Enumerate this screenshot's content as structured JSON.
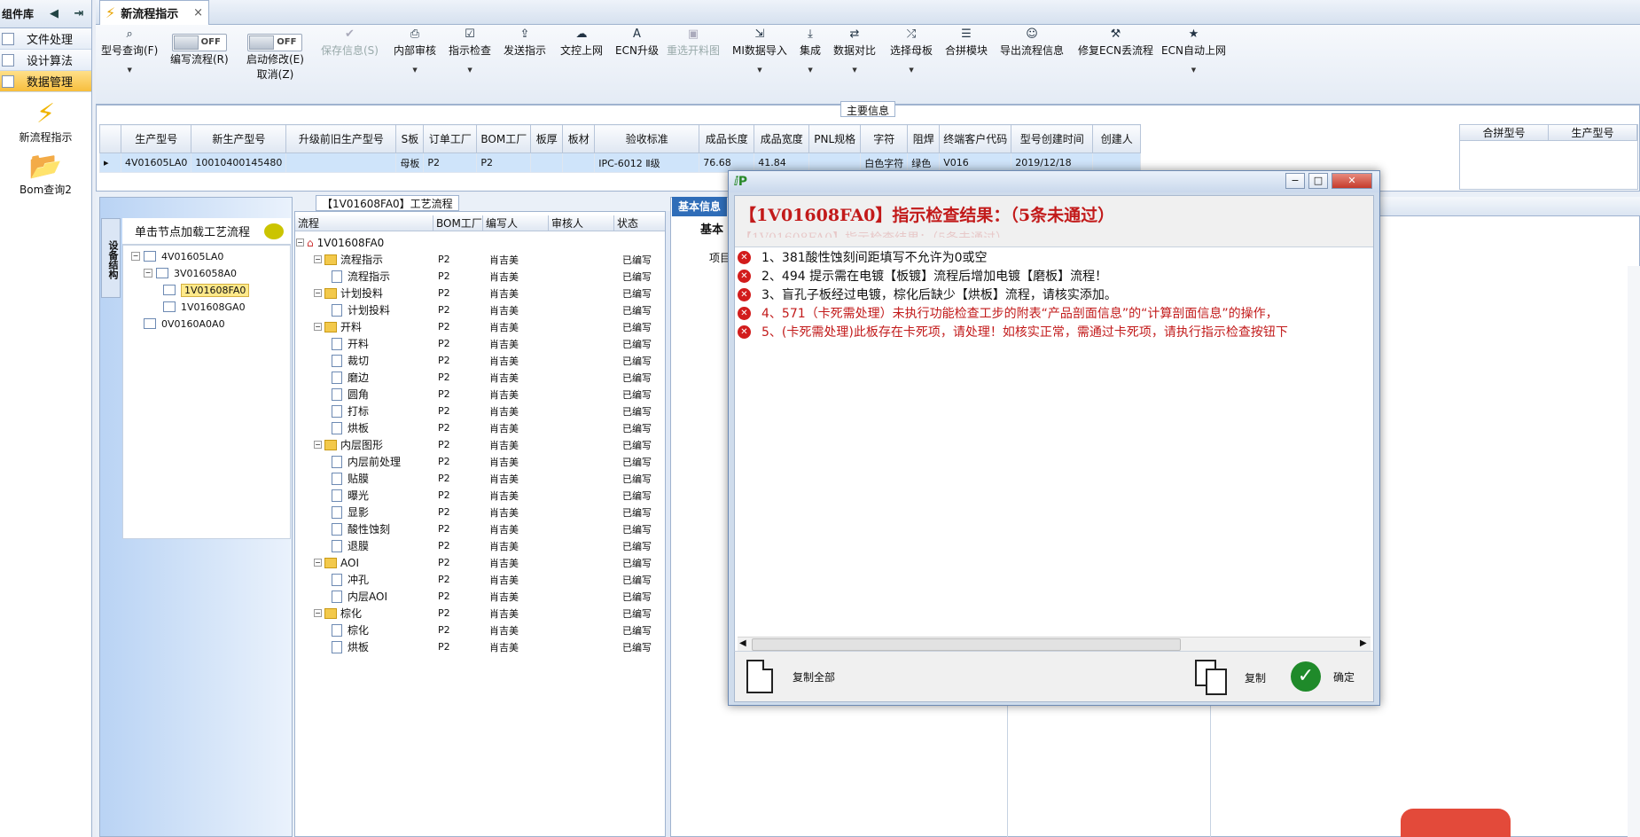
{
  "left_panel": {
    "title": "组件库",
    "nav_items": [
      "文件处理",
      "设计算法",
      "数据管理"
    ],
    "active_item": "数据管理",
    "big_items": [
      "新流程指示",
      "Bom查询2"
    ]
  },
  "tab": {
    "label": "新流程指示"
  },
  "toolbar": {
    "model_query": "型号查询(F)",
    "edit_flow": "编写流程(R)",
    "toggle_off": "OFF",
    "start_modify": "启动修改(E)",
    "cancel": "取消(Z)",
    "save_info": "保存信息(S)",
    "internal_review": "内部审核",
    "indicator_check": "指示检查",
    "send_indicator": "发送指示",
    "file_control_upload": "文控上网",
    "ecn_upgrade": "ECN升级",
    "reselect_cut_chart": "重选开料图",
    "mi_import": "MI数据导入",
    "aggregate": "集成",
    "data_compare": "数据对比",
    "select_master": "选择母板",
    "merge_module": "合拼模块",
    "export_flow_info": "导出流程信息",
    "repair_ecn_lost_flow": "修复ECN丢流程",
    "ecn_auto_upload": "ECN自动上网"
  },
  "main_info": {
    "title": "主要信息",
    "columns": [
      "生产型号",
      "新生产型号",
      "升级前旧生产型号",
      "S板",
      "订单工厂",
      "BOM工厂",
      "板厚",
      "板材",
      "验收标准",
      "成品长度",
      "成品宽度",
      "PNL规格",
      "字符",
      "阻焊",
      "终端客户代码",
      "型号创建时间",
      "创建人"
    ],
    "row": [
      "4V01605LA0",
      "10010400145480",
      "",
      "母板",
      "P2",
      "P2",
      "",
      "",
      "IPC-6012 Ⅱ级",
      "76.68",
      "41.84",
      "",
      "白色字符",
      "绿色",
      "V016",
      "2019/12/18",
      ""
    ],
    "side_columns": [
      "合拼型号",
      "生产型号"
    ]
  },
  "tree": {
    "vertical_tab": "设备结构",
    "header": "单击节点加载工艺流程",
    "nodes": [
      "4V01605LA0",
      "3V016058A0",
      "1V01608FA0",
      "1V01608GA0",
      "0V0160A0A0"
    ],
    "selected": "1V01608FA0"
  },
  "process": {
    "title": "【1V01608FA0】工艺流程",
    "columns": [
      "流程",
      "BOM工厂",
      "编写人",
      "审核人",
      "状态"
    ],
    "root": "1V01608FA0",
    "rows": [
      {
        "name": "流程指示",
        "level": 1,
        "folder": true,
        "bom": "P2",
        "writer": "肖吉美",
        "status": "已编写"
      },
      {
        "name": "流程指示",
        "level": 2,
        "folder": false,
        "bom": "P2",
        "writer": "肖吉美",
        "status": "已编写"
      },
      {
        "name": "计划投料",
        "level": 1,
        "folder": true,
        "bom": "P2",
        "writer": "肖吉美",
        "status": "已编写"
      },
      {
        "name": "计划投料",
        "level": 2,
        "folder": false,
        "bom": "P2",
        "writer": "肖吉美",
        "status": "已编写"
      },
      {
        "name": "开料",
        "level": 1,
        "folder": true,
        "bom": "P2",
        "writer": "肖吉美",
        "status": "已编写"
      },
      {
        "name": "开料",
        "level": 2,
        "folder": false,
        "bom": "P2",
        "writer": "肖吉美",
        "status": "已编写"
      },
      {
        "name": "裁切",
        "level": 2,
        "folder": false,
        "bom": "P2",
        "writer": "肖吉美",
        "status": "已编写"
      },
      {
        "name": "磨边",
        "level": 2,
        "folder": false,
        "bom": "P2",
        "writer": "肖吉美",
        "status": "已编写"
      },
      {
        "name": "圆角",
        "level": 2,
        "folder": false,
        "bom": "P2",
        "writer": "肖吉美",
        "status": "已编写"
      },
      {
        "name": "打标",
        "level": 2,
        "folder": false,
        "bom": "P2",
        "writer": "肖吉美",
        "status": "已编写"
      },
      {
        "name": "烘板",
        "level": 2,
        "folder": false,
        "bom": "P2",
        "writer": "肖吉美",
        "status": "已编写"
      },
      {
        "name": "内层图形",
        "level": 1,
        "folder": true,
        "bom": "P2",
        "writer": "肖吉美",
        "status": "已编写"
      },
      {
        "name": "内层前处理",
        "level": 2,
        "folder": false,
        "bom": "P2",
        "writer": "肖吉美",
        "status": "已编写"
      },
      {
        "name": "贴膜",
        "level": 2,
        "folder": false,
        "bom": "P2",
        "writer": "肖吉美",
        "status": "已编写"
      },
      {
        "name": "曝光",
        "level": 2,
        "folder": false,
        "bom": "P2",
        "writer": "肖吉美",
        "status": "已编写"
      },
      {
        "name": "显影",
        "level": 2,
        "folder": false,
        "bom": "P2",
        "writer": "肖吉美",
        "status": "已编写"
      },
      {
        "name": "酸性蚀刻",
        "level": 2,
        "folder": false,
        "bom": "P2",
        "writer": "肖吉美",
        "status": "已编写"
      },
      {
        "name": "退膜",
        "level": 2,
        "folder": false,
        "bom": "P2",
        "writer": "肖吉美",
        "status": "已编写"
      },
      {
        "name": "AOI",
        "level": 1,
        "folder": true,
        "bom": "P2",
        "writer": "肖吉美",
        "status": "已编写"
      },
      {
        "name": "冲孔",
        "level": 2,
        "folder": false,
        "bom": "P2",
        "writer": "肖吉美",
        "status": "已编写"
      },
      {
        "name": "内层AOI",
        "level": 2,
        "folder": false,
        "bom": "P2",
        "writer": "肖吉美",
        "status": "已编写"
      },
      {
        "name": "棕化",
        "level": 1,
        "folder": true,
        "bom": "P2",
        "writer": "肖吉美",
        "status": "已编写"
      },
      {
        "name": "棕化",
        "level": 2,
        "folder": false,
        "bom": "P2",
        "writer": "肖吉美",
        "status": "已编写"
      },
      {
        "name": "烘板",
        "level": 2,
        "folder": false,
        "bom": "P2",
        "writer": "肖吉美",
        "status": "已编写"
      }
    ]
  },
  "right_panel": {
    "basic_tab": "基本信息",
    "basic_sub": "基本",
    "item_label": "项目"
  },
  "dialog": {
    "heading": "【1V01608FA0】指示检查结果：（5条未通过）",
    "errors": [
      {
        "text": "1、381酸性蚀刻间距填写不允许为0或空",
        "color": "#111111"
      },
      {
        "text": "2、494 提示需在电镀【板镀】流程后增加电镀【磨板】流程！",
        "color": "#111111"
      },
      {
        "text": "3、盲孔子板经过电镀，棕化后缺少【烘板】流程，请核实添加。",
        "color": "#111111"
      },
      {
        "text": "4、571（卡死需处理）未执行功能检查工步的附表“产品剖面信息”的“计算剖面信息”的操作，",
        "color": "#c21a1a"
      },
      {
        "text": "5、(卡死需处理)此板存在卡死项，请处理！如核实正常，需通过卡死项，请执行指示检查按钮下",
        "color": "#c21a1a"
      }
    ],
    "copy_all": "复制全部",
    "copy": "复制",
    "confirm": "确定"
  }
}
